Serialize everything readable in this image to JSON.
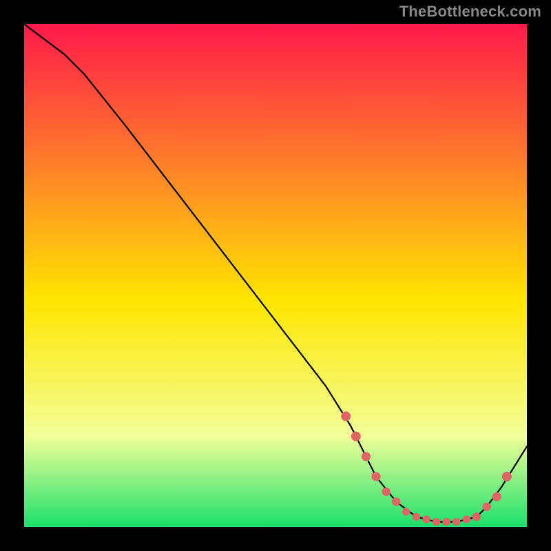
{
  "watermark": "TheBottleneck.com",
  "colors": {
    "frame": "#000000",
    "line": "#000000",
    "marker": "#E06565",
    "gradient_top": "#FF1A4A",
    "gradient_mid_upper": "#FF7F2A",
    "gradient_mid": "#FFE600",
    "gradient_lower": "#F2FF99",
    "gradient_bottom": "#1BE06B"
  },
  "chart_data": {
    "type": "line",
    "title": "",
    "xlabel": "",
    "ylabel": "",
    "x_range": [
      0,
      100
    ],
    "y_range": [
      0,
      100
    ],
    "series": [
      {
        "name": "curve",
        "x": [
          0,
          4,
          8,
          12,
          20,
          30,
          40,
          50,
          60,
          65,
          68,
          70,
          74,
          78,
          82,
          86,
          90,
          92,
          95,
          100
        ],
        "y": [
          100,
          97,
          94,
          90,
          80,
          67,
          54,
          41,
          28,
          20,
          14,
          10,
          5,
          2,
          1,
          1,
          2,
          4,
          8,
          16
        ]
      }
    ],
    "markers": {
      "name": "points",
      "x": [
        64,
        66,
        68,
        70,
        72,
        74,
        76,
        78,
        80,
        82,
        84,
        86,
        88,
        90,
        92,
        94,
        96
      ],
      "y": [
        22,
        18,
        14,
        10,
        7,
        5,
        3,
        2,
        1.5,
        1,
        1,
        1,
        1.5,
        2,
        4,
        6,
        10
      ],
      "r": [
        3.2,
        3.2,
        3.0,
        3.0,
        2.8,
        2.8,
        2.6,
        2.6,
        2.6,
        2.6,
        2.6,
        2.6,
        2.6,
        2.8,
        2.8,
        3.0,
        3.2
      ]
    }
  }
}
